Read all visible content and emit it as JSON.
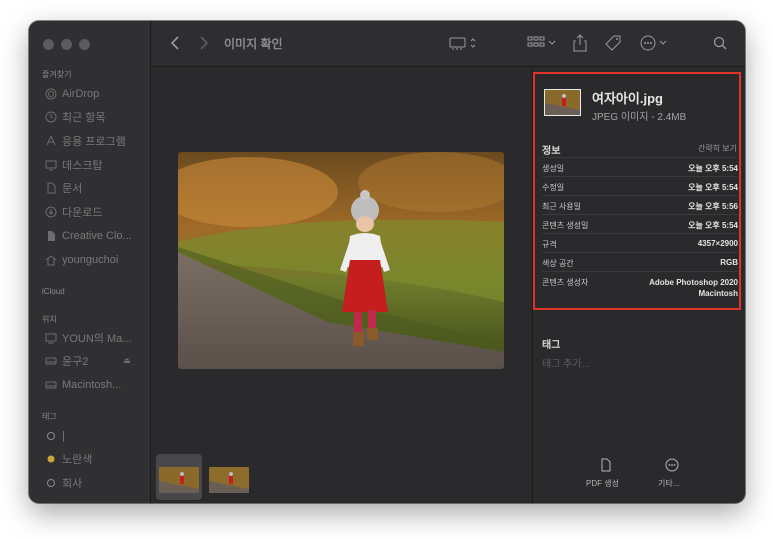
{
  "window": {
    "title": "이미지 확인"
  },
  "sidebar": {
    "favorites_title": "즐겨찾기",
    "favorites": [
      {
        "label": "AirDrop",
        "icon": "airdrop-icon"
      },
      {
        "label": "최근 항목",
        "icon": "clock-icon"
      },
      {
        "label": "응용 프로그램",
        "icon": "applications-icon"
      },
      {
        "label": "데스크탑",
        "icon": "desktop-icon"
      },
      {
        "label": "문서",
        "icon": "document-icon"
      },
      {
        "label": "다운로드",
        "icon": "download-icon"
      },
      {
        "label": "Creative Clo...",
        "icon": "file-icon"
      },
      {
        "label": "younguchoi",
        "icon": "home-icon"
      }
    ],
    "icloud_title": "iCloud",
    "locations_title": "위치",
    "locations": [
      {
        "label": "YOUN의 Ma...",
        "icon": "computer-icon"
      },
      {
        "label": "윤구2",
        "icon": "disk-icon"
      },
      {
        "label": "Macintosh...",
        "icon": "disk-icon"
      }
    ],
    "tags_title": "태그",
    "tags": [
      {
        "label": "|",
        "color": "#8a898c"
      },
      {
        "label": "노란색",
        "color": "#c9a53a"
      },
      {
        "label": "회사",
        "color": "#8a898c"
      }
    ]
  },
  "inspector": {
    "file_name": "여자아이.jpg",
    "file_sub": "JPEG 이미지 - 2.4MB",
    "info_title": "정보",
    "show_less": "간략히 보기",
    "rows": [
      {
        "key": "생성일",
        "value": "오늘 오후 5:54"
      },
      {
        "key": "수정일",
        "value": "오늘 오후 5:54"
      },
      {
        "key": "최근 사용일",
        "value": "오늘 오후 5:56"
      },
      {
        "key": "콘텐츠 생성일",
        "value": "오늘 오후 5:54"
      },
      {
        "key": "규격",
        "value": "4357×2900"
      },
      {
        "key": "색상 공간",
        "value": "RGB"
      },
      {
        "key": "콘텐츠 생성자",
        "value": "Adobe Photoshop 2020",
        "value2": "Macintosh"
      }
    ],
    "tags_title": "태그",
    "tags_placeholder": "태그 추가...",
    "actions": [
      {
        "label": "PDF 생성",
        "icon": "document-icon"
      },
      {
        "label": "기타...",
        "icon": "more-icon"
      }
    ],
    "highlight_color": "#e0332a"
  }
}
